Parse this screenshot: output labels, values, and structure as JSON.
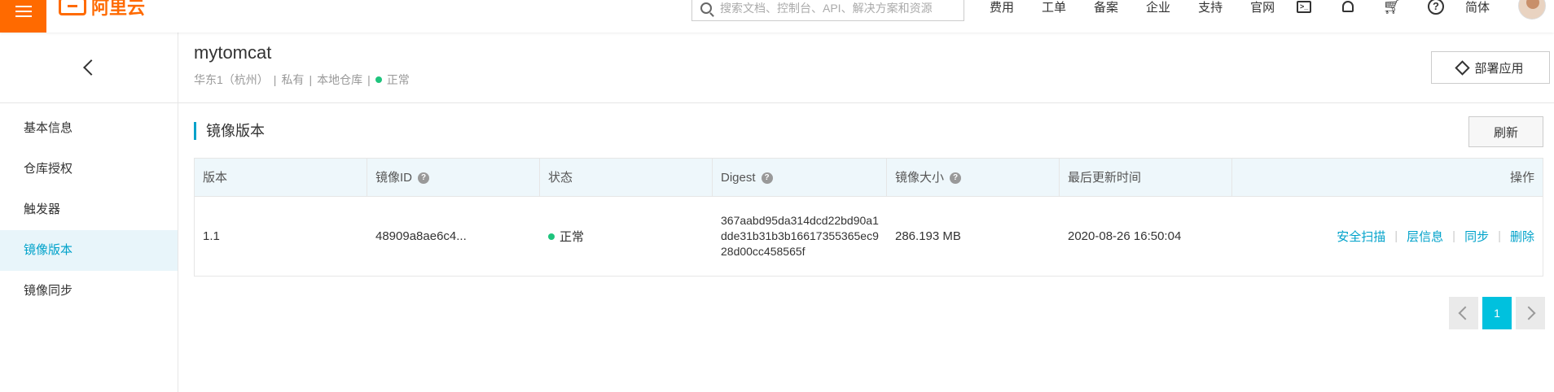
{
  "topbar": {
    "logo_text": "阿里云",
    "search_placeholder": "搜索文档、控制台、API、解决方案和资源",
    "nav": [
      "费用",
      "工单",
      "备案",
      "企业",
      "支持",
      "官网"
    ],
    "lang": "简体",
    "brand_color": "#ff6a00"
  },
  "sidebar": {
    "items": [
      {
        "label": "基本信息",
        "active": false
      },
      {
        "label": "仓库授权",
        "active": false
      },
      {
        "label": "触发器",
        "active": false
      },
      {
        "label": "镜像版本",
        "active": true
      },
      {
        "label": "镜像同步",
        "active": false
      }
    ]
  },
  "repo": {
    "name": "mytomcat",
    "region": "华东1（杭州）",
    "visibility": "私有",
    "source": "本地仓库",
    "status": "正常",
    "deploy_label": "部署应用"
  },
  "section": {
    "title": "镜像版本",
    "refresh_label": "刷新"
  },
  "table": {
    "headers": [
      "版本",
      "镜像ID",
      "状态",
      "Digest",
      "镜像大小",
      "最后更新时间",
      "操作"
    ],
    "rows": [
      {
        "version": "1.1",
        "image_id": "48909a8ae6c4...",
        "status": "正常",
        "digest": "367aabd95da314dcd22bd90a1dde31b31b3b16617355365ec928d00cc458565f",
        "size": "286.193 MB",
        "updated": "2020-08-26 16:50:04",
        "ops": [
          "安全扫描",
          "层信息",
          "同步",
          "删除"
        ]
      }
    ]
  },
  "pagination": {
    "current": "1"
  },
  "colors": {
    "accent": "#00a2ca",
    "status_ok": "#1ec47d",
    "page_active": "#00c1de"
  }
}
